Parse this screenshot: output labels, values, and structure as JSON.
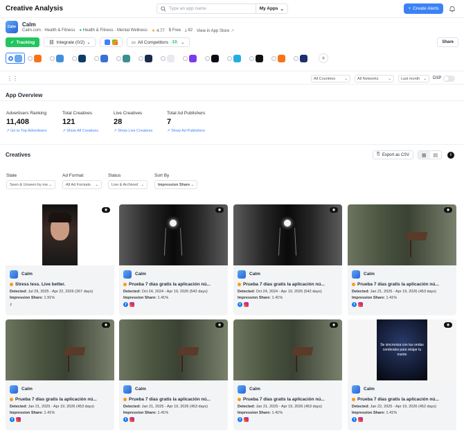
{
  "header": {
    "title": "Creative Analysis",
    "search_placeholder": "Type an app name",
    "my_apps": "My Apps",
    "create_alerts": "Create Alerts"
  },
  "app": {
    "name": "Calm",
    "icon_text": "Calm",
    "developer": "Calm.com · Health & Fitness",
    "category": "Health & Fitness · Mental Wellness",
    "rating": "4.77",
    "price": "Free",
    "downloads": "82",
    "store_link": "View in App Store"
  },
  "actions": {
    "tracking": "Tracking",
    "integrate": "Integrate (0/2)",
    "competitors": "All Competitors",
    "competitors_count": "13",
    "share": "Share"
  },
  "competitor_colors": [
    "#6aa8f0",
    "#f97316",
    "#3f8fdc",
    "#0f3b6b",
    "#3b6fd6",
    "#3a8f8f",
    "#1a2a4a",
    "#e9e9ef",
    "#7c3aed",
    "#0b0b16",
    "#22aee0",
    "#111111",
    "#f97316",
    "#1f2f6b"
  ],
  "filters": {
    "countries": "All Countries",
    "networks": "All Networks",
    "period": "Last month",
    "dsp": "DSP"
  },
  "overview": {
    "title": "App Overview",
    "stats": [
      {
        "label": "Advertisers Ranking",
        "value": "11,408",
        "link": "Go to Top Advertisers"
      },
      {
        "label": "Total Creatives",
        "value": "121",
        "link": "Show All Creatives"
      },
      {
        "label": "Live Creatives",
        "value": "28",
        "link": "Show Live Creatives"
      },
      {
        "label": "Total Ad Publishers",
        "value": "7",
        "link": "Show Ad Publishers"
      }
    ]
  },
  "creatives": {
    "title": "Creatives",
    "export": "Export as CSV",
    "filters": [
      {
        "label": "State",
        "value": "Seen & Unseen by me"
      },
      {
        "label": "Ad Format",
        "value": "All Ad Formats"
      },
      {
        "label": "Status",
        "value": "Live & Archived"
      },
      {
        "label": "Sort By",
        "value": "Impression Share"
      }
    ],
    "cards": [
      {
        "app": "Calm",
        "title": "Stress less. Live better.",
        "detected": "Jul 29, 2025 - Apr 22, 2026 (267 days)",
        "share": "1.91%",
        "platforms": [
          "tiktok"
        ],
        "thumb": "portrait",
        "caption": ""
      },
      {
        "app": "Calm",
        "title": "Prueba 7 días gratis la aplicación nú...",
        "detected": "Oct 24, 2024 - Apr 19, 2026 (542 days)",
        "share": "1.41%",
        "platforms": [
          "facebook",
          "instagram"
        ],
        "thumb": "lamp",
        "caption": ""
      },
      {
        "app": "Calm",
        "title": "Prueba 7 días gratis la aplicación nú...",
        "detected": "Oct 24, 2024 - Apr 19, 2026 (542 days)",
        "share": "1.41%",
        "platforms": [
          "facebook",
          "instagram"
        ],
        "thumb": "lamp",
        "caption": ""
      },
      {
        "app": "Calm",
        "title": "Prueba 7 días gratis la aplicación nú...",
        "detected": "Jan 21, 2025 - Apr 19, 2026 (453 days)",
        "share": "1.41%",
        "platforms": [
          "facebook",
          "instagram"
        ],
        "thumb": "forest",
        "caption": ""
      },
      {
        "app": "Calm",
        "title": "Prueba 7 días gratis la aplicación nú...",
        "detected": "Jan 21, 2025 - Apr 19, 2026 (453 days)",
        "share": "1.41%",
        "platforms": [
          "facebook",
          "instagram"
        ],
        "thumb": "forest",
        "caption": ""
      },
      {
        "app": "Calm",
        "title": "Prueba 7 días gratis la aplicación nú...",
        "detected": "Jan 21, 2025 - Apr 19, 2026 (453 days)",
        "share": "1.41%",
        "platforms": [
          "facebook",
          "instagram"
        ],
        "thumb": "forest",
        "caption": ""
      },
      {
        "app": "Calm",
        "title": "Prueba 7 días gratis la aplicación nú...",
        "detected": "Jan 21, 2025 - Apr 19, 2026 (453 days)",
        "share": "1.41%",
        "platforms": [
          "facebook",
          "instagram"
        ],
        "thumb": "forest",
        "caption": ""
      },
      {
        "app": "Calm",
        "title": "Prueba 7 días gratis la aplicación nú...",
        "detected": "Jan 22, 2025 - Apr 19, 2026 (452 days)",
        "share": "1.41%",
        "platforms": [
          "facebook",
          "instagram"
        ],
        "thumb": "brain",
        "caption": "Se sincroniza con tus ondas cerebrales para relajar tu mente"
      }
    ],
    "detected_label": "Detected:",
    "share_label": "Impression Share:"
  }
}
